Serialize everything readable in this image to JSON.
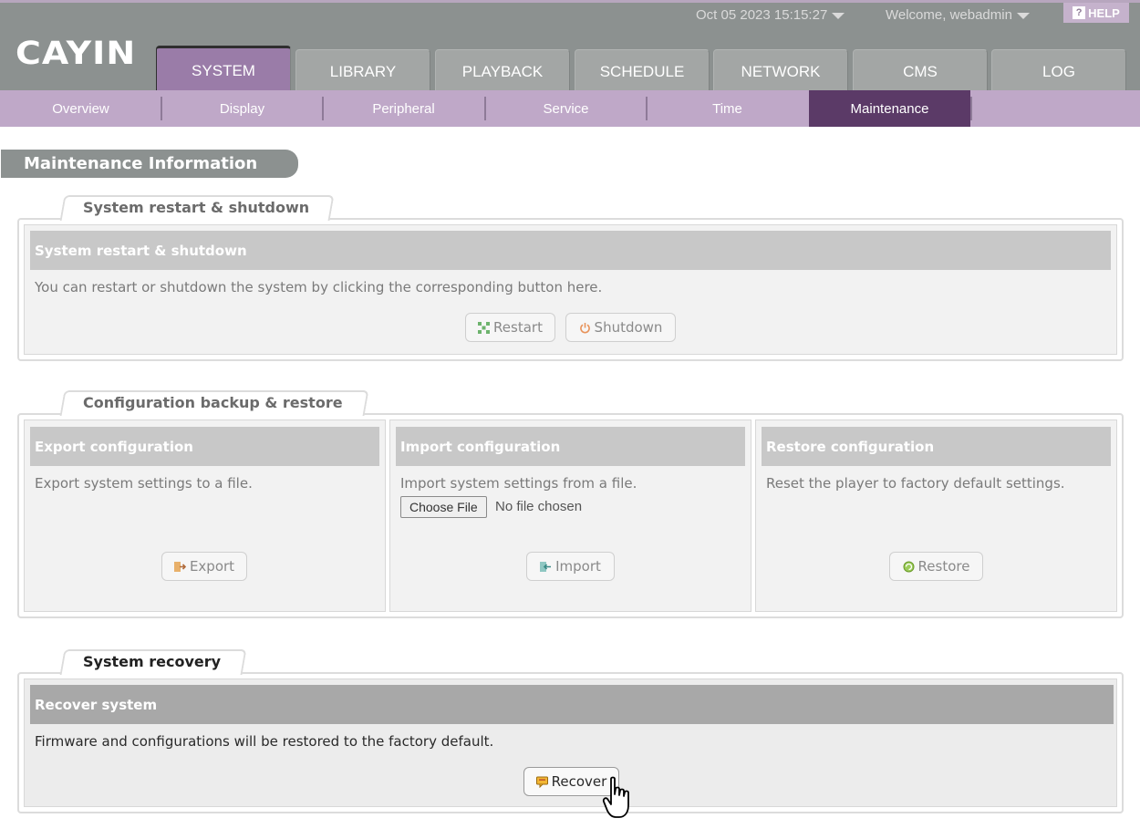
{
  "header": {
    "logo": "CAYIN",
    "datetime": "Oct 05 2023 15:15:27",
    "welcome": "Welcome, webadmin",
    "help_label": "HELP",
    "help_q": "?"
  },
  "main_tabs": [
    {
      "label": "SYSTEM",
      "active": true
    },
    {
      "label": "LIBRARY"
    },
    {
      "label": "PLAYBACK"
    },
    {
      "label": "SCHEDULE"
    },
    {
      "label": "NETWORK"
    },
    {
      "label": "CMS"
    },
    {
      "label": "LOG"
    }
  ],
  "sub_tabs": [
    {
      "label": "Overview"
    },
    {
      "label": "Display"
    },
    {
      "label": "Peripheral"
    },
    {
      "label": "Service"
    },
    {
      "label": "Time"
    },
    {
      "label": "Maintenance",
      "active": true
    }
  ],
  "page_title": "Maintenance Information",
  "sections": {
    "restart": {
      "tab_label": "System restart & shutdown",
      "panel_title": "System restart & shutdown",
      "description": "You can restart or shutdown the system by clicking the corresponding button here.",
      "restart_label": "Restart",
      "shutdown_label": "Shutdown"
    },
    "config": {
      "tab_label": "Configuration backup & restore",
      "export": {
        "title": "Export configuration",
        "description": "Export system settings to a file.",
        "button_label": "Export"
      },
      "import": {
        "title": "Import configuration",
        "description": "Import system settings from a file.",
        "choose_file_label": "Choose File",
        "file_status": "No file chosen",
        "button_label": "Import"
      },
      "restore": {
        "title": "Restore configuration",
        "description": "Reset the player to factory default settings.",
        "button_label": "Restore"
      }
    },
    "recovery": {
      "tab_label": "System recovery",
      "panel_title": "Recover system",
      "description": "Firmware and configurations will be restored to the factory default.",
      "button_label": "Recover"
    }
  },
  "colors": {
    "header_bg": "#8c9190",
    "active_tab": "#9a7ca8",
    "subnav_bg": "#bfa8c8",
    "subnav_active": "#5b3a67"
  }
}
